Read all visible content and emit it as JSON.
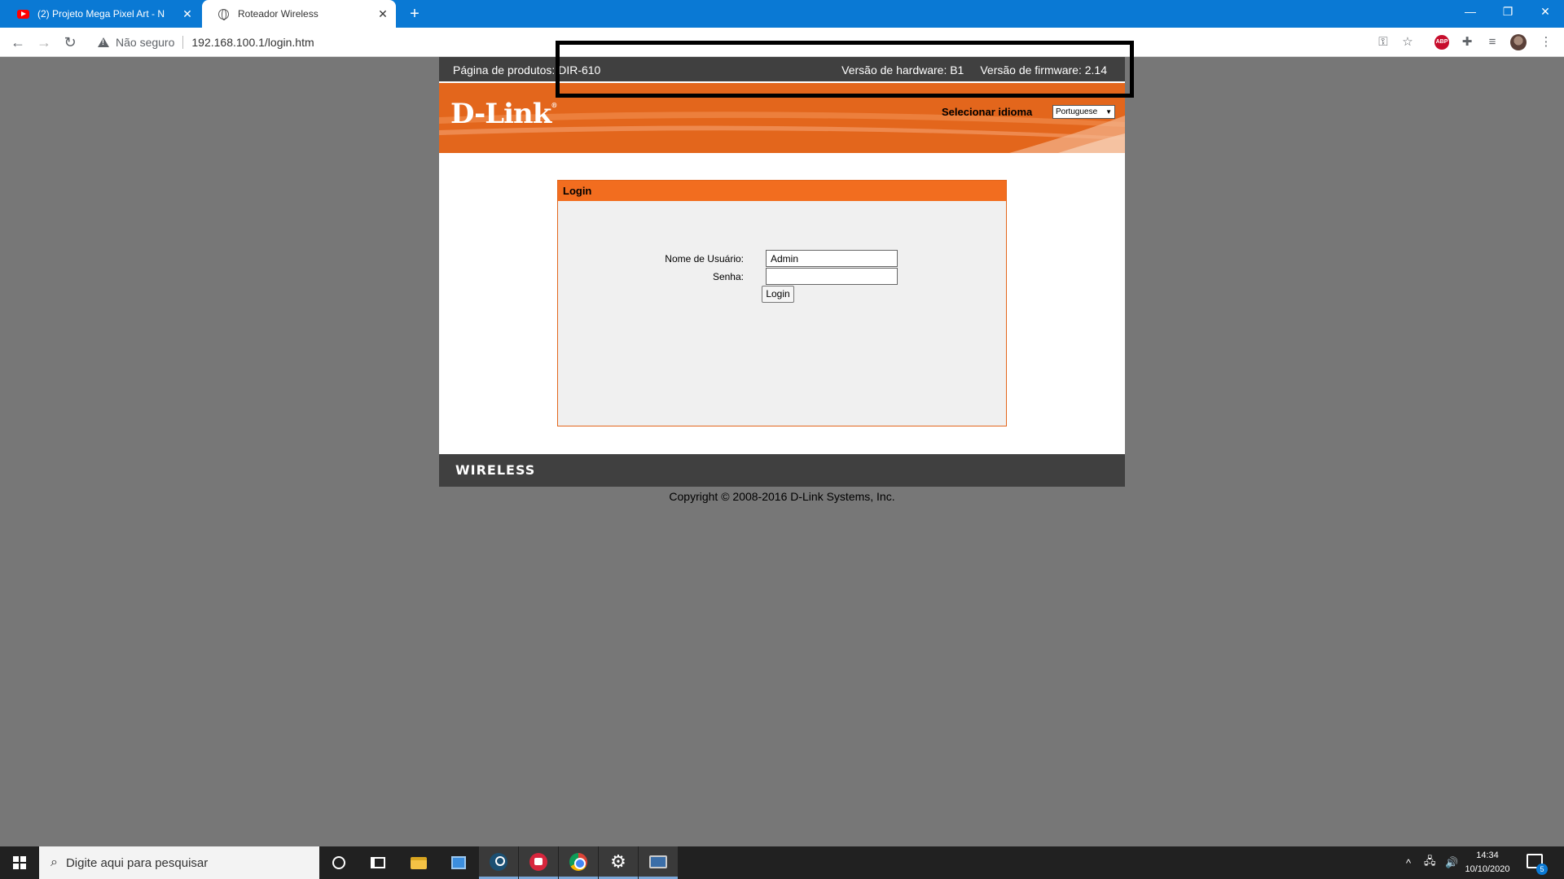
{
  "browser": {
    "tabs": [
      {
        "title": "(2) Projeto Mega Pixel Art - N",
        "icon": "youtube-icon"
      },
      {
        "title": "Roteador Wireless",
        "icon": "globe-icon"
      }
    ],
    "new_tab": "+",
    "window_controls": {
      "minimize": "—",
      "restore": "❐",
      "close": "✕"
    },
    "security_label": "Não seguro",
    "url": "192.168.100.1/login.htm"
  },
  "router": {
    "product_label": "Página de produtos: DIR-610",
    "hardware_version": "Versão de hardware: B1",
    "firmware_version": "Versão de firmware: 2.14",
    "logo": "D-Link",
    "logo_mark": "®",
    "language_label": "Selecionar idioma",
    "language_value": "Portuguese",
    "login": {
      "title": "Login",
      "username_label": "Nome de Usuário:",
      "username_value": "Admin",
      "password_label": "Senha:",
      "password_value": "",
      "button": "Login"
    },
    "footer_brand": "WIRELESS",
    "copyright": "Copyright © 2008-2016 D-Link Systems, Inc."
  },
  "taskbar": {
    "search_placeholder": "Digite aqui para pesquisar",
    "time": "14:34",
    "date": "10/10/2020",
    "notifications": "5"
  },
  "colors": {
    "chrome_blue": "#0a79d4",
    "dlink_orange": "#e3661c",
    "router_dark": "#404040"
  }
}
